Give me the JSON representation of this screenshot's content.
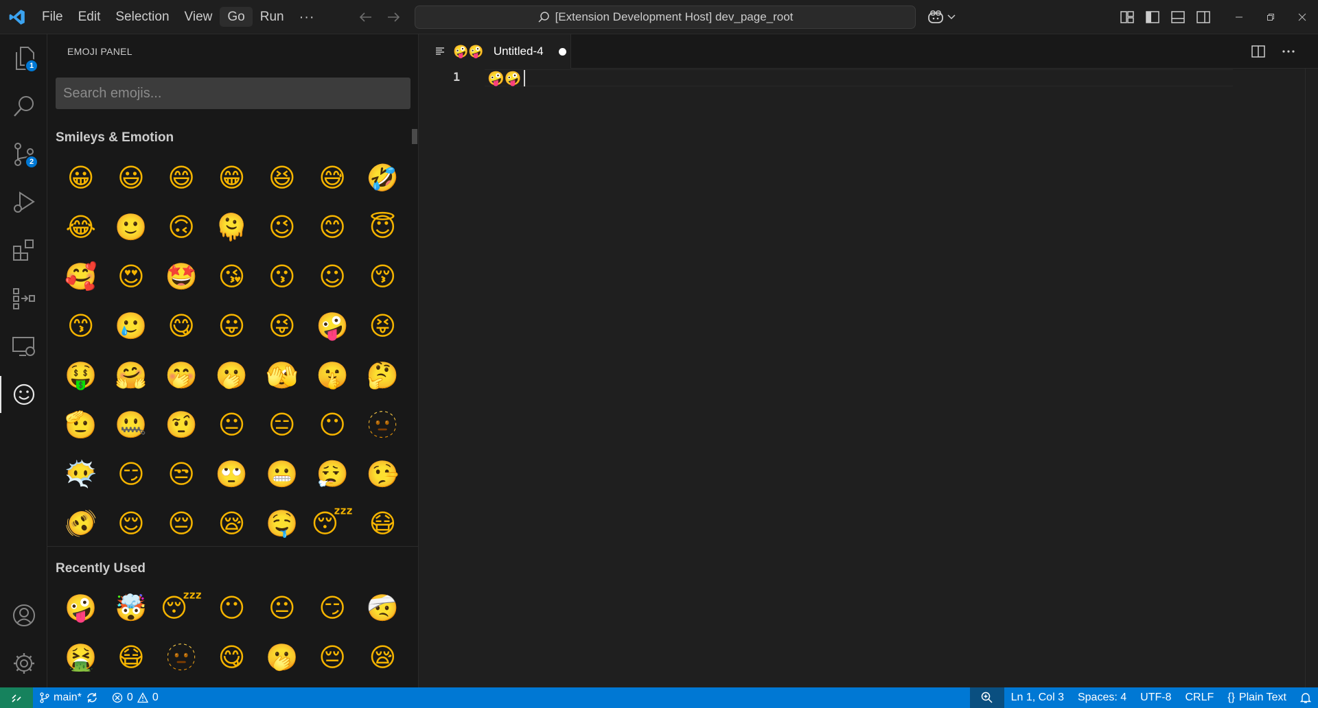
{
  "menu": {
    "items": [
      "File",
      "Edit",
      "Selection",
      "View",
      "Go",
      "Run"
    ],
    "more": "···"
  },
  "command_center": {
    "text": "[Extension Development Host] dev_page_root"
  },
  "activity_bar": {
    "explorer_badge": "1",
    "scm_badge": "2"
  },
  "sidebar": {
    "title": "EMOJI PANEL",
    "search_placeholder": "Search emojis...",
    "smileys_title": "Smileys & Emotion",
    "smileys": [
      "😀",
      "😃",
      "😄",
      "😁",
      "😆",
      "😅",
      "🤣",
      "😂",
      "🙂",
      "🙃",
      "🫠",
      "😉",
      "😊",
      "😇",
      "🥰",
      "😍",
      "🤩",
      "😘",
      "😗",
      "☺",
      "😚",
      "😙",
      "🥲",
      "😋",
      "😛",
      "😜",
      "🤪",
      "😝",
      "🤑",
      "🤗",
      "🤭",
      "🫢",
      "🫣",
      "🤫",
      "🤔",
      "🫡",
      "🤐",
      "🤨",
      "😐",
      "😑",
      "😶",
      "🫥",
      "😶‍🌫️",
      "😏",
      "😒",
      "🙄",
      "😬",
      "😮‍💨",
      "🤥",
      "🫨",
      "😌",
      "😔",
      "😪",
      "🤤",
      "😴",
      "😷"
    ],
    "recent_title": "Recently Used",
    "recent": [
      "🤪",
      "🤯",
      "😴",
      "😶",
      "😐",
      "😏",
      "🤕",
      "🤮",
      "😷",
      "🫥",
      "😋",
      "🫢",
      "😔",
      "😪"
    ]
  },
  "editor": {
    "tab_emojis": "🤪🤪",
    "tab_label": "Untitled-4",
    "line_number": "1",
    "line_content": "🤪🤪"
  },
  "status_bar": {
    "branch": "main*",
    "errors": "0",
    "warnings": "0",
    "position": "Ln 1, Col 3",
    "spaces": "Spaces: 4",
    "encoding": "UTF-8",
    "eol": "CRLF",
    "language": "Plain Text",
    "language_icon": "{}"
  },
  "colors": {
    "accent": "#0078d4",
    "remote": "#16825d",
    "emoji": "#f5b400"
  }
}
